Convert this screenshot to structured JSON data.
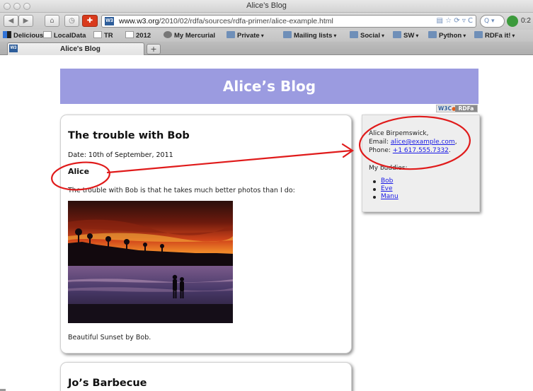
{
  "window": {
    "title": "Alice’s Blog"
  },
  "navbar": {
    "url_domain": "www.w3.org",
    "url_path": "/2010/02/rdfa/sources/rdfa-primer/alice-example.html",
    "url_icons": "▤ ☆ ⟳ ▿ C",
    "search_placeholder": "Q ▾",
    "ext_label": "0:2"
  },
  "bookmarks": [
    {
      "label": "Delicious",
      "icon": "delicious-icon"
    },
    {
      "label": "LocalData",
      "icon": "page-icon"
    },
    {
      "label": "TR",
      "icon": "page-icon"
    },
    {
      "label": "2012",
      "icon": "page-icon"
    },
    {
      "label": "My Mercurial",
      "icon": "mercurial-icon"
    },
    {
      "label": "Private",
      "icon": "folder-icon"
    },
    {
      "label": "Mailing lists",
      "icon": "folder-icon"
    },
    {
      "label": "Social",
      "icon": "folder-icon"
    },
    {
      "label": "SW",
      "icon": "folder-icon"
    },
    {
      "label": "Python",
      "icon": "folder-icon"
    },
    {
      "label": "RDFa it!",
      "icon": "folder-icon"
    }
  ],
  "tabs": [
    {
      "label": "Alice's Blog",
      "active": true
    }
  ],
  "new_tab_label": "+",
  "page": {
    "header": "Alice’s Blog",
    "badge_w3c": "W3C",
    "badge_rdfa": "RDFa",
    "post1": {
      "title": "The trouble with Bob",
      "date": "Date: 10th of September, 2011",
      "author": "Alice",
      "body": "The trouble with Bob is that he takes much better photos than I do:",
      "caption": "Beautiful Sunset by Bob."
    },
    "post2": {
      "title": "Jo’s Barbecue"
    },
    "sidebar": {
      "name": "Alice Birpemswick,",
      "email_label": "Email: ",
      "email": "alice@example.com",
      "email_suffix": ",",
      "phone_label": "Phone: ",
      "phone": "+1 617.555.7332",
      "phone_suffix": ".",
      "buddies_label": "My buddies:",
      "buddies": [
        "Bob",
        "Eve",
        "Manu"
      ]
    }
  },
  "colors": {
    "banner": "#9b9be0",
    "link": "#1a1ae6",
    "annotation": "#e01b1b"
  }
}
